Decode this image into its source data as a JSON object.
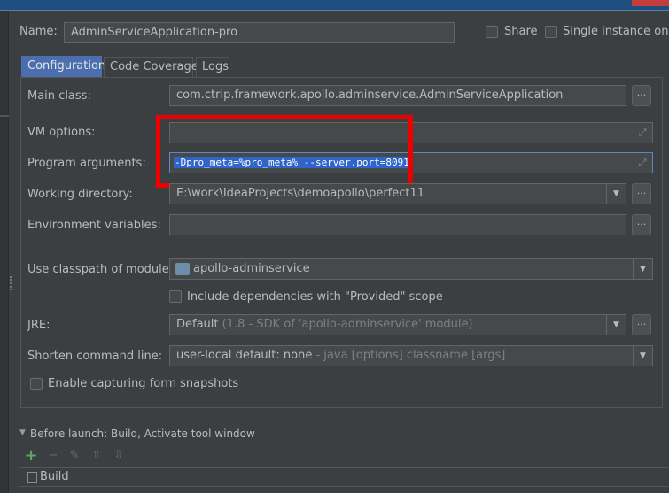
{
  "header": {
    "name_label": "Name:",
    "name_value": "AdminServiceApplication-pro",
    "share_label": "Share",
    "single_instance_label": "Single instance only"
  },
  "tabs": [
    {
      "label": "Configuration"
    },
    {
      "label": "Code Coverage"
    },
    {
      "label": "Logs"
    }
  ],
  "form": {
    "main_class_label": "Main class:",
    "main_class_value": "com.ctrip.framework.apollo.adminservice.AdminServiceApplication",
    "vm_options_label": "VM options:",
    "vm_options_value": "",
    "program_args_label": "Program arguments:",
    "program_args_value": "-Dpro_meta=%pro_meta% --server.port=8091",
    "working_dir_label": "Working directory:",
    "working_dir_value": "E:\\work\\IdeaProjects\\demoapollo\\perfect11",
    "env_vars_label": "Environment variables:",
    "env_vars_value": "",
    "classpath_label": "Use classpath of module:",
    "classpath_value": "apollo-adminservice",
    "include_deps_label": "Include dependencies with \"Provided\" scope",
    "jre_label": "JRE:",
    "jre_value_main": "Default",
    "jre_value_detail": "(1.8 - SDK of 'apollo-adminservice' module)",
    "shorten_label": "Shorten command line:",
    "shorten_value_main": "user-local default: none",
    "shorten_value_detail": "- java [options] classname [args]",
    "capture_label": "Enable capturing form snapshots"
  },
  "before_launch": {
    "title": "Before launch: Build, Activate tool window",
    "item": "Build"
  },
  "icons": {
    "ellipsis": "...",
    "expand": "⤢",
    "arrow_down": "▼",
    "add": "+",
    "remove": "−",
    "edit": "✎",
    "up": "⇧",
    "down": "⇩"
  },
  "colors": {
    "background": "#3c3f41",
    "selected_tab": "#4b6eaf",
    "selection": "#2f65ca",
    "highlight_box": "#ee0000",
    "add_icon": "#59a869"
  }
}
